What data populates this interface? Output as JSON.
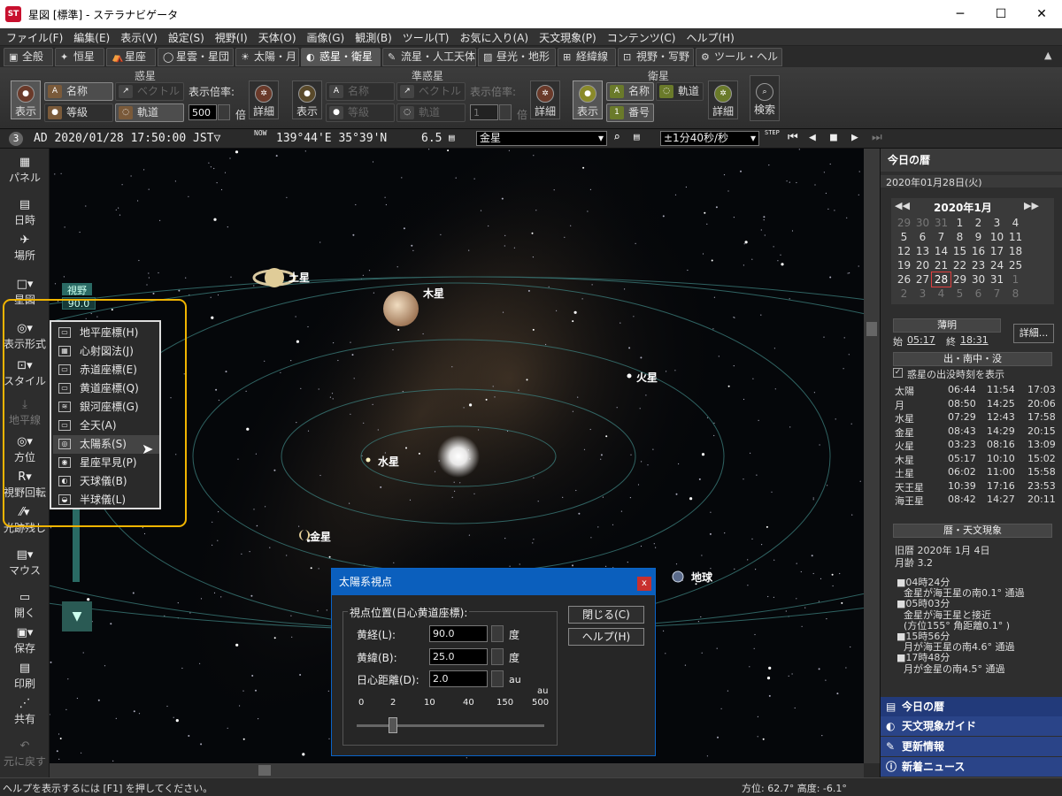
{
  "window": {
    "title": "星図 [標準] - ステラナビゲータ",
    "minimize": "─",
    "maximize": "☐",
    "close": "✕",
    "app_icon": "ST"
  },
  "menu": [
    "ファイル(F)",
    "編集(E)",
    "表示(V)",
    "設定(S)",
    "視野(I)",
    "天体(O)",
    "画像(G)",
    "観測(B)",
    "ツール(T)",
    "お気に入り(A)",
    "天文現象(P)",
    "コンテンツ(C)",
    "ヘルプ(H)"
  ],
  "tabs": [
    {
      "label": "全般",
      "icon": "▣"
    },
    {
      "label": "恒星",
      "icon": "✦"
    },
    {
      "label": "星座",
      "icon": "⛺"
    },
    {
      "label": "星雲・星団",
      "icon": "◯"
    },
    {
      "label": "太陽・月",
      "icon": "☀"
    },
    {
      "label": "惑星・衛星",
      "icon": "◐"
    },
    {
      "label": "流星・人工天体",
      "icon": "✎"
    },
    {
      "label": "昼光・地形",
      "icon": "▨"
    },
    {
      "label": "経緯線",
      "icon": "⊞"
    },
    {
      "label": "視野・写野",
      "icon": "⊡"
    },
    {
      "label": "ツール・ヘルプ",
      "icon": "⚙"
    }
  ],
  "ribbon": {
    "planets": {
      "group": "惑星",
      "show": "表示",
      "name": "名称",
      "grade": "等級",
      "vector": "ベクトル",
      "orbit": "軌道",
      "scale_label": "表示倍率:",
      "scale_value": "500",
      "scale_unit": "倍",
      "detail": "詳細"
    },
    "minor": {
      "group": "準惑星",
      "show": "表示",
      "name": "名称",
      "grade": "等級",
      "vector": "ベクトル",
      "orbit": "軌道",
      "scale_label": "表示倍率:",
      "scale_value": "1",
      "scale_unit": "倍",
      "detail": "詳細"
    },
    "sats": {
      "group": "衛星",
      "show": "表示",
      "name": "名称",
      "orbit": "軌道",
      "number": "番号",
      "detail": "詳細"
    },
    "search": "検索"
  },
  "status": {
    "num": "3",
    "datetime": "AD 2020/01/28 17:50:00 JST▽",
    "now": "NOW",
    "location": "139°44'E 35°39'N",
    "mag": "6.5",
    "object": "金星",
    "speed": "±1分40秒/秒",
    "step": "STEP"
  },
  "left_tools": [
    {
      "label": "パネル",
      "icon": "▦"
    },
    {
      "label": "日時",
      "icon": "▤"
    },
    {
      "label": "場所",
      "icon": "✈"
    },
    {
      "label": "星図",
      "icon": "□▾"
    },
    {
      "label": "表示形式",
      "icon": "◎▾"
    },
    {
      "label": "スタイル",
      "icon": "⊡▾"
    },
    {
      "label": "地平線",
      "icon": "⤓"
    },
    {
      "label": "方位",
      "icon": "◎▾"
    },
    {
      "label": "視野回転",
      "icon": "R▾"
    },
    {
      "label": "光跡残し",
      "icon": "⁄⁄▾"
    },
    {
      "label": "マウス",
      "icon": "▤▾"
    },
    {
      "label": "開く",
      "icon": "▭"
    },
    {
      "label": "保存",
      "icon": "▣▾"
    },
    {
      "label": "印刷",
      "icon": "▤"
    },
    {
      "label": "共有",
      "icon": "⋰"
    },
    {
      "label": "元に戻す",
      "icon": "↶"
    }
  ],
  "fov": {
    "label": "視野",
    "value": "90.0"
  },
  "popup_menu": [
    {
      "label": "地平座標(H)",
      "icon": "▭"
    },
    {
      "label": "心射図法(J)",
      "icon": "▦"
    },
    {
      "label": "赤道座標(E)",
      "icon": "▭"
    },
    {
      "label": "黄道座標(Q)",
      "icon": "▭"
    },
    {
      "label": "銀河座標(G)",
      "icon": "≋"
    },
    {
      "label": "全天(A)",
      "icon": "▭"
    },
    {
      "label": "太陽系(S)",
      "icon": "◎"
    },
    {
      "label": "星座早見(P)",
      "icon": "◉"
    },
    {
      "label": "天球儀(B)",
      "icon": "◐"
    },
    {
      "label": "半球儀(L)",
      "icon": "◒"
    }
  ],
  "planets": {
    "saturn": "土星",
    "jupiter": "木星",
    "mars": "火星",
    "mercury": "水星",
    "venus": "金星",
    "earth": "地球"
  },
  "dialog": {
    "title": "太陽系視点",
    "close": "x",
    "group": "視点位置(日心黄道座標):",
    "lon_label": "黄経(L):",
    "lon": "90.0",
    "lon_unit": "度",
    "lat_label": "黄緯(B):",
    "lat": "25.0",
    "lat_unit": "度",
    "dist_label": "日心距離(D):",
    "dist": "2.0",
    "dist_unit": "au",
    "btn_close": "閉じる(C)",
    "btn_help": "ヘルプ(H)",
    "scale_unit": "au",
    "ticks": [
      "0",
      "2",
      "10",
      "40",
      "150",
      "500"
    ]
  },
  "panel": {
    "header": "今日の暦",
    "date": "2020年01月28日(火)",
    "month": "2020年1月",
    "cal": [
      [
        "29",
        "30",
        "31",
        "1",
        "2",
        "3",
        "4"
      ],
      [
        "5",
        "6",
        "7",
        "8",
        "9",
        "10",
        "11"
      ],
      [
        "12",
        "13",
        "14",
        "15",
        "16",
        "17",
        "18"
      ],
      [
        "19",
        "20",
        "21",
        "22",
        "23",
        "24",
        "25"
      ],
      [
        "26",
        "27",
        "28",
        "29",
        "30",
        "31",
        "1"
      ],
      [
        "2",
        "3",
        "4",
        "5",
        "6",
        "7",
        "8"
      ]
    ],
    "twilight": "薄明",
    "start": "始",
    "start_t": "05:17",
    "end": "終",
    "end_t": "18:31",
    "detail_btn": "詳細...",
    "rise_title": "出・南中・没",
    "rise_check": "惑星の出没時刻を表示",
    "rise": [
      [
        "太陽",
        "06:44",
        "11:54",
        "17:03"
      ],
      [
        "月",
        "08:50",
        "14:25",
        "20:06"
      ],
      [
        "水星",
        "07:29",
        "12:43",
        "17:58"
      ],
      [
        "金星",
        "08:43",
        "14:29",
        "20:15"
      ],
      [
        "火星",
        "03:23",
        "08:16",
        "13:09"
      ],
      [
        "木星",
        "05:17",
        "10:10",
        "15:02"
      ],
      [
        "土星",
        "06:02",
        "11:00",
        "15:58"
      ],
      [
        "天王星",
        "10:39",
        "17:16",
        "23:53"
      ],
      [
        "海王星",
        "08:42",
        "14:27",
        "20:11"
      ]
    ],
    "ev_title": "暦・天文現象",
    "lunar": "旧暦  2020年  1月 4日",
    "age": "月齢  3.2",
    "events": [
      "■04時24分",
      "金星が海王星の南0.1°  通過",
      "■05時03分",
      "金星が海王星と接近",
      "(方位155°  角距離0.1°  )",
      "■15時56分",
      "月が海王星の南4.6°  通過",
      "■17時48分",
      "月が金星の南4.5°  通過"
    ],
    "nav": [
      "今日の暦",
      "天文現象ガイド",
      "更新情報",
      "新着ニュース"
    ]
  },
  "bottom": {
    "help": "ヘルプを表示するには [F1] を押してください。",
    "az": "方位:  62.7° 高度:  -6.1°"
  }
}
